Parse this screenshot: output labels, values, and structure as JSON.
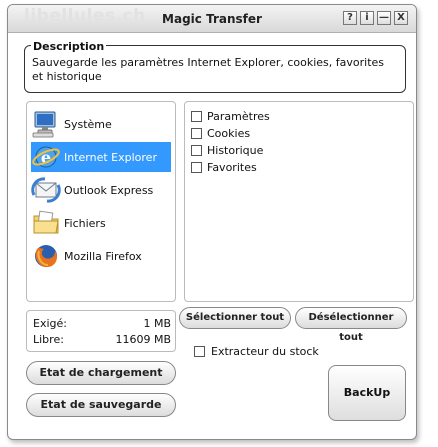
{
  "window": {
    "watermark": "libellules.ch",
    "title": "Magic Transfer",
    "buttons": [
      "?",
      "i",
      "—",
      "X"
    ]
  },
  "description": {
    "legend": "Description",
    "text": "Sauvegarde les paramètres Internet Explorer, cookies, favorites et historique"
  },
  "apps": [
    {
      "label": "Système",
      "icon": "computer-icon",
      "selected": false
    },
    {
      "label": "Internet Explorer",
      "icon": "internet-explorer-icon",
      "selected": true
    },
    {
      "label": "Outlook Express",
      "icon": "outlook-express-icon",
      "selected": false
    },
    {
      "label": "Fichiers",
      "icon": "folder-icon",
      "selected": false
    },
    {
      "label": "Mozilla Firefox",
      "icon": "firefox-icon",
      "selected": false
    }
  ],
  "options": [
    {
      "label": "Paramètres",
      "checked": false
    },
    {
      "label": "Cookies",
      "checked": false
    },
    {
      "label": "Historique",
      "checked": false
    },
    {
      "label": "Favorites",
      "checked": false
    }
  ],
  "info": {
    "required_label": "Exigé:",
    "required_value": "1 MB",
    "free_label": "Libre:",
    "free_value": "11609 MB"
  },
  "actions": {
    "select_all": "Sélectionner tout",
    "deselect_all": "Désélectionner tout",
    "stock_extractor": "Extracteur du stock",
    "load_state": "Etat de chargement",
    "save_state": "Etat de sauvegarde",
    "backup": "BackUp"
  },
  "colors": {
    "selection": "#3399ff"
  }
}
